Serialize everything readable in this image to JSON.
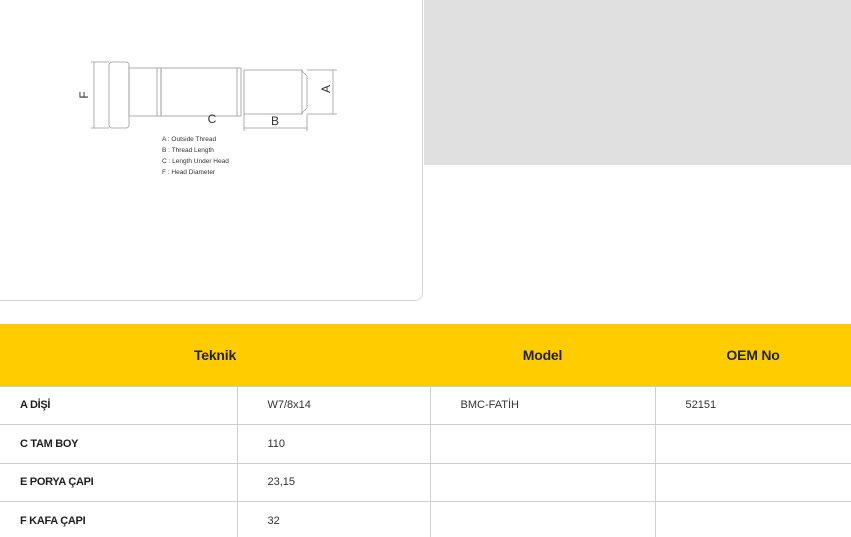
{
  "diagram": {
    "dim_labels": {
      "a": "A",
      "b": "B",
      "c": "C",
      "f": "F"
    },
    "legend": [
      "A : Outside Thread",
      "B : Thread Length",
      "C : Length Under Head",
      "F : Head Diameter"
    ]
  },
  "table": {
    "headers": {
      "teknik": "Teknik",
      "model": "Model",
      "oem": "OEM No"
    },
    "rows": [
      {
        "label": "A DİŞİ",
        "value": "W7/8x14",
        "model": "BMC-FATİH",
        "oem": "52151"
      },
      {
        "label": "C TAM BOY",
        "value": "110",
        "model": "",
        "oem": ""
      },
      {
        "label": "E PORYA ÇAPI",
        "value": "23,15",
        "model": "",
        "oem": ""
      },
      {
        "label": "F KAFA ÇAPI",
        "value": "32",
        "model": "",
        "oem": ""
      }
    ]
  }
}
